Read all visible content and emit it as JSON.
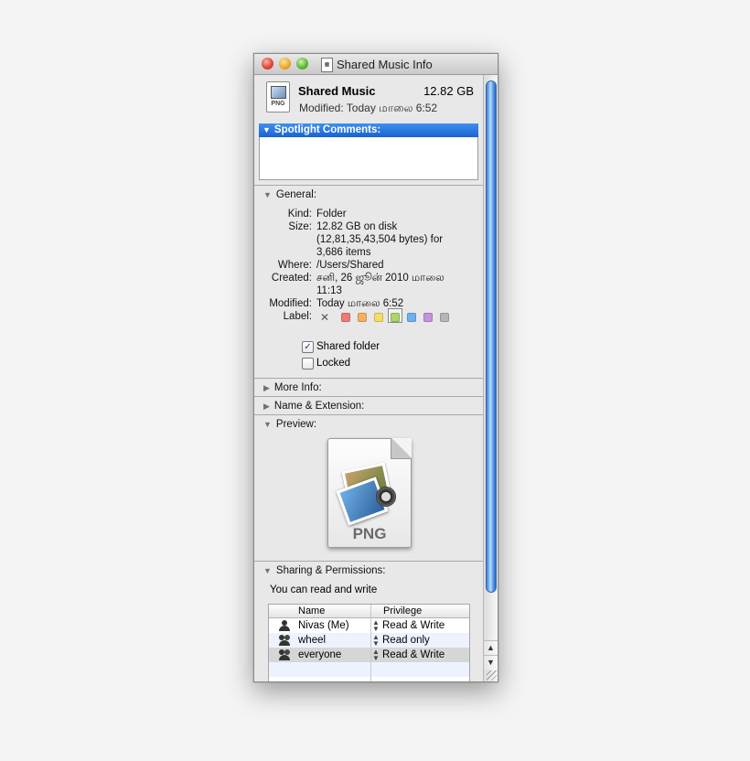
{
  "window": {
    "title": "Shared Music Info"
  },
  "header": {
    "name": "Shared Music",
    "size": "12.82 GB",
    "modified": "Modified: Today மாலை 6:52",
    "icon_text": "PNG"
  },
  "spotlight": {
    "label": "Spotlight Comments:",
    "value": ""
  },
  "general": {
    "label": "General:",
    "kind_label": "Kind:",
    "kind": "Folder",
    "size_label": "Size:",
    "size_lines": [
      "12.82 GB on disk",
      "(12,81,35,43,504 bytes) for",
      "3,686 items"
    ],
    "where_label": "Where:",
    "where": "/Users/Shared",
    "created_label": "Created:",
    "created_lines": [
      "சனி, 26 ஜூன் 2010 மாலை",
      "11:13"
    ],
    "modified_label": "Modified:",
    "modified": "Today மாலை 6:52",
    "label_label": "Label:",
    "label_none": "✕",
    "label_colors": [
      "#ef7a72",
      "#f5b15e",
      "#f2df63",
      "#a9d66a",
      "#6fb0f0",
      "#c693dd",
      "#b6b6b6"
    ],
    "selected_label_index": 3,
    "shared_folder_label": "Shared folder",
    "shared_folder_checked": true,
    "locked_label": "Locked",
    "locked_checked": false
  },
  "sections": {
    "more_info": "More Info:",
    "name_ext": "Name & Extension:",
    "preview": "Preview:",
    "sharing": "Sharing & Permissions:"
  },
  "preview": {
    "doc_text": "PNG"
  },
  "sharing": {
    "summary": "You can read and write",
    "columns": {
      "name": "Name",
      "privilege": "Privilege"
    },
    "rows": [
      {
        "name": "Nivas (Me)",
        "privilege": "Read & Write",
        "icon": "user-icon"
      },
      {
        "name": "wheel",
        "privilege": "Read only",
        "icon": "group-icon"
      },
      {
        "name": "everyone",
        "privilege": "Read & Write",
        "icon": "group-icon"
      }
    ]
  },
  "scroll": {
    "up": "▲",
    "down": "▼"
  },
  "icons": {
    "disclosure_open": "▼",
    "disclosure_closed": "▶",
    "checkmark": "✓"
  }
}
